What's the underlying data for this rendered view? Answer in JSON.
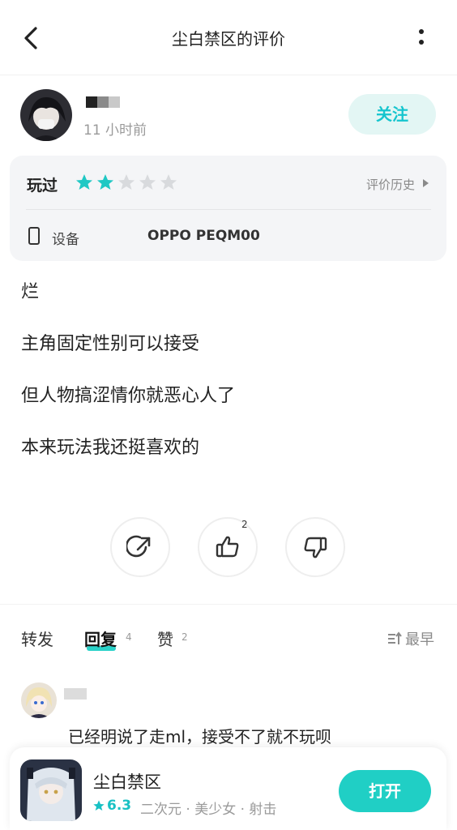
{
  "header": {
    "title": "尘白禁区的评价",
    "back_icon": "back-arrow-icon",
    "more_icon": "more-vertical-icon"
  },
  "author": {
    "time": "11 小时前",
    "follow_label": "关注"
  },
  "rating_card": {
    "played_label": "玩过",
    "stars_filled": 2,
    "stars_total": 5,
    "history_label": "评价历史",
    "device_label": "设备",
    "device_value": "OPPO PEQM00"
  },
  "review": {
    "lines": [
      "烂",
      "主角固定性别可以接受",
      "但人物搞涩情你就恶心人了",
      "本来玩法我还挺喜欢的"
    ]
  },
  "actions": {
    "like_count": "2"
  },
  "tabs": {
    "forward": "转发",
    "reply": "回复",
    "reply_count": "4",
    "like": "赞",
    "like_count": "2",
    "sort_label": "最早"
  },
  "reply": {
    "text": "已经明说了走ml，接受不了就不玩呗"
  },
  "game": {
    "name": "尘白禁区",
    "rating": "6.3",
    "tags": "二次元 · 美少女 · 射击",
    "open_label": "打开"
  },
  "colors": {
    "accent": "#20cfc5",
    "star_filled": "#1fc8c4",
    "star_empty": "#d8dadd"
  }
}
